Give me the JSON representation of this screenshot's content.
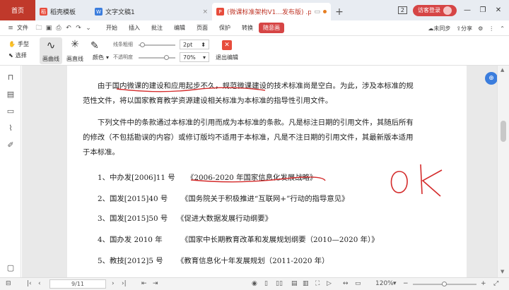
{
  "tabs": {
    "home": "首页",
    "t1": "稻壳模板",
    "t2": "文字文稿1",
    "t3": "(微课标准架构V1...发布版) .pdf"
  },
  "titlebar": {
    "page_badge": "2",
    "login": "访客登录"
  },
  "menu": {
    "file": "文件",
    "items": [
      "开始",
      "插入",
      "批注",
      "编辑",
      "页面",
      "保护",
      "转换"
    ],
    "active": "随意画",
    "sync": "未同步",
    "share": "分享"
  },
  "ribbon": {
    "hand": "手型",
    "select": "选择",
    "curve": "画曲线",
    "line": "画直线",
    "color": "颜色",
    "line_width_label": "线条粗细",
    "line_width": "2pt",
    "opacity_label": "不透明度",
    "opacity": "70%",
    "exit": "退出编辑"
  },
  "document": {
    "para1_line1": "由于国内微课的建设和应用起步不久，规范微课建设的技术标准尚是空白。为此，涉及本标准的规",
    "para1_line2": "范性文件，将以国家教育教学资源建设相关标准为本标准的指导性引用文件。",
    "para2_line1": "下列文件中的条款通过本标准的引用而成为本标准的条款。凡是标注日期的引用文件，其随后所有",
    "para2_line2": "的修改（不包括勘误的内容）或修订版均不适用于本标准，凡是不注日期的引用文件，其最新版本适用",
    "para2_line3": "于本标准。",
    "refs": [
      {
        "code": "1、中办发[2006]11 号",
        "title": "《2006-2020 年国家信息化发展战略》"
      },
      {
        "code": "2、国发[2015]40 号",
        "title": "《国务院关于积极推进“互联网+”行动的指导意见》"
      },
      {
        "code": "3、国发[2015]50 号",
        "title": "《促进大数据发展行动纲要》"
      },
      {
        "code": "4、国办发 2010 年",
        "title": "《国家中长期教育改革和发展规划纲要（2010—2020 年）》"
      },
      {
        "code": "5、教技[2012]5 号",
        "title": "《教育信息化十年发展规划（2011-2020 年）"
      }
    ]
  },
  "statusbar": {
    "page": "9/11",
    "zoom": "120%"
  },
  "colors": {
    "accent": "#d64545",
    "ink": "#d42b2b"
  }
}
